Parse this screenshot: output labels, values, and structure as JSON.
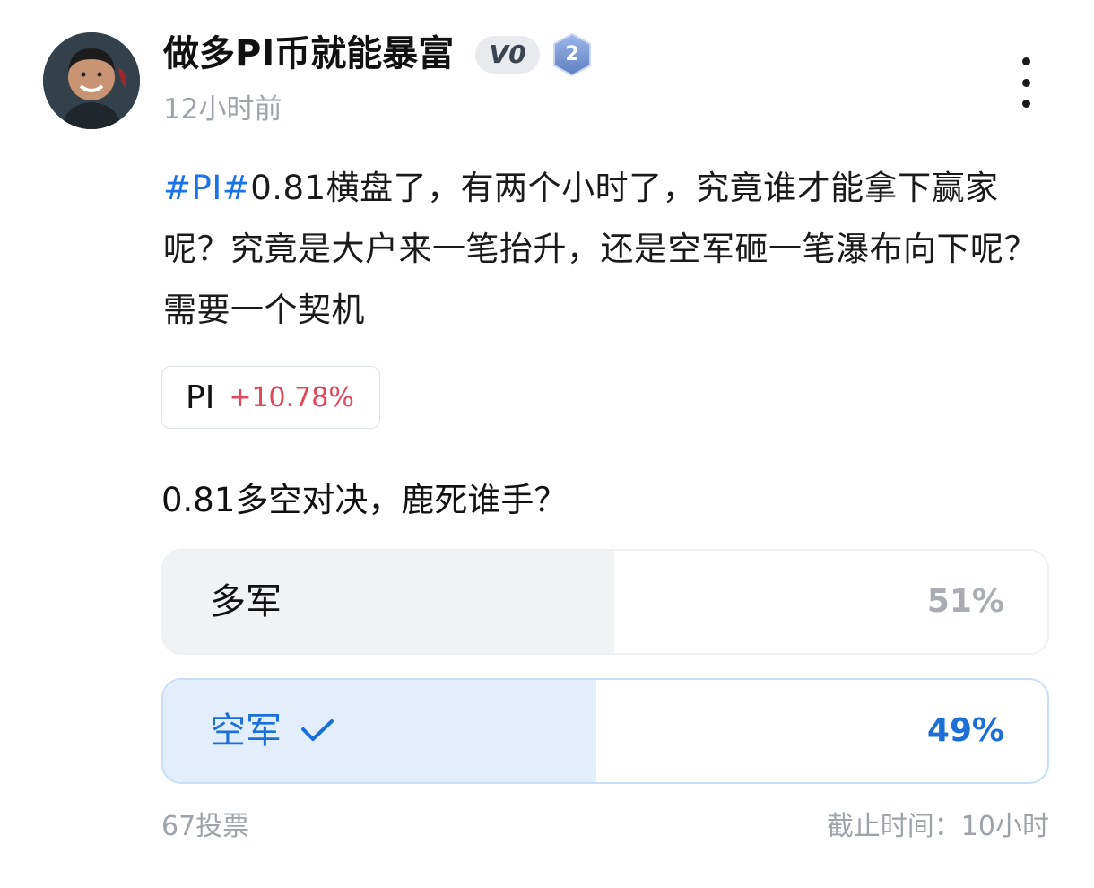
{
  "author": {
    "name": "做多PI币就能暴富",
    "vip_badge": "V0",
    "level": "2",
    "time": "12小时前"
  },
  "post": {
    "hashtag": "#PI#",
    "text": "0.81横盘了，有两个小时了，究竟谁才能拿下赢家呢？究竟是大户来一笔抬升，还是空军砸一笔瀑布向下呢？需要一个契机"
  },
  "coin": {
    "symbol": "PI",
    "change": "+10.78%",
    "change_color": "#e0475a"
  },
  "poll": {
    "question": "0.81多空对决，鹿死谁手？",
    "options": [
      {
        "label": "多军",
        "percent_text": "51%",
        "percent": 51,
        "selected": false
      },
      {
        "label": "空军",
        "percent_text": "49%",
        "percent": 49,
        "selected": true
      }
    ],
    "votes": "67投票",
    "deadline": "截止时间：10小时"
  },
  "colors": {
    "accent": "#1b6fd6",
    "hashtag": "#1a73e8"
  },
  "icons": [
    "more-vertical-icon",
    "check-icon",
    "level-badge-icon"
  ]
}
